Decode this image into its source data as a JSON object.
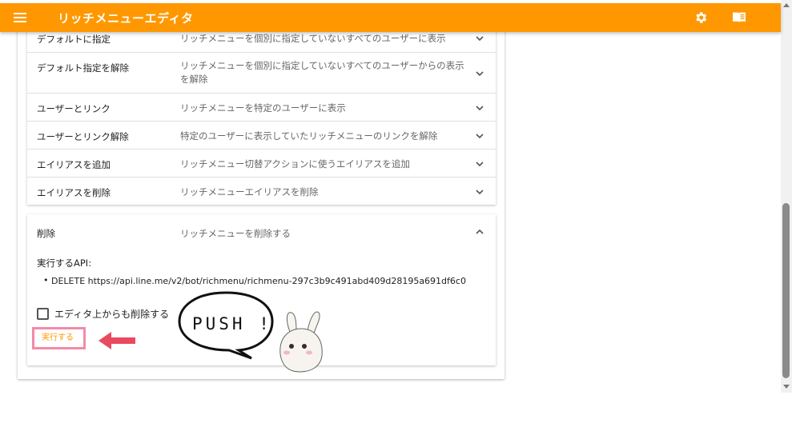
{
  "app": {
    "title": "リッチメニューエディタ"
  },
  "rows": [
    {
      "label": "デフォルトに指定",
      "desc": "リッチメニューを個別に指定していないすべてのユーザーに表示"
    },
    {
      "label": "デフォルト指定を解除",
      "desc": "リッチメニューを個別に指定していないすべてのユーザーからの表示を解除"
    },
    {
      "label": "ユーザーとリンク",
      "desc": "リッチメニューを特定のユーザーに表示"
    },
    {
      "label": "ユーザーとリンク解除",
      "desc": "特定のユーザーに表示していたリッチメニューのリンクを解除"
    },
    {
      "label": "エイリアスを追加",
      "desc": "リッチメニュー切替アクションに使うエイリアスを追加"
    },
    {
      "label": "エイリアスを削除",
      "desc": "リッチメニューエイリアスを削除"
    }
  ],
  "open_panel": {
    "label": "削除",
    "desc": "リッチメニューを削除する",
    "api_title": "実行するAPI:",
    "api_item": "DELETE https://api.line.me/v2/bot/richmenu/richmenu-297c3b9c491abd409d28195a691df6c0",
    "checkbox_label": "エディタ上からも削除する",
    "run_label": "実行する"
  },
  "annotation": {
    "speech": "PUSH !"
  },
  "colors": {
    "accent": "#ff9800",
    "highlight": "#f48aa8",
    "arrow": "#e84a5f"
  }
}
